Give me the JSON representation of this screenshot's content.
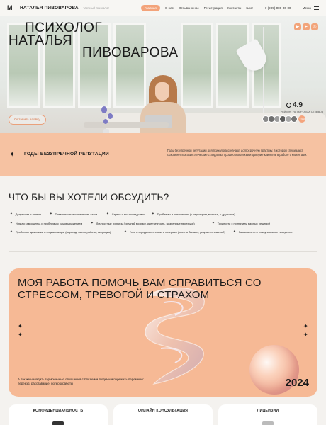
{
  "header": {
    "logo": "M",
    "brand": "НАТАЛЬЯ ПИВОВАРОВА",
    "brand_sub": "частный психолог",
    "nav": [
      "Главная",
      "О нас",
      "Отзывы о нас",
      "Регистрация",
      "Контакты",
      "Блог"
    ],
    "active_nav": "Главная",
    "phone": "+7 (999) 000-00-00",
    "menu_label": "Меню"
  },
  "hero": {
    "title_line1": "ПСИХОЛОГ",
    "title_line2": "НАТАЛЬЯ",
    "title_line3": "ПИВОВАРОВА",
    "cta_label": "Оставить заявку",
    "rating": "4.9",
    "rating_sub": "РЕЙТИНГ НА ПОРТАЛАХ ОТЗЫВОВ",
    "avatars_plus": "+4м",
    "social_icons": [
      "youtube-icon",
      "telegram-icon",
      "instagram-icon"
    ]
  },
  "reputation": {
    "title": "ГОДЫ БЕЗУПРЕЧНОЙ РЕПУТАЦИИ",
    "text": "Годы безупречной репутации для психолога означают долгосрочную практику, в которой специалист сохраняет высокие этические стандарты, профессионализм и доверие клиентов в работе с клиентами."
  },
  "topics": {
    "title": "ЧТО БЫ ВЫ ХОТЕЛИ ОБСУДИТЬ?",
    "items": [
      "Депрессия и апатия",
      "Тревожность и панические атаки",
      "Стресс и его последствия",
      "Проблемы в отношениях (с партнером, в семье, с друзьями)",
      "Низкая самооценка и проблемы с самовыражением",
      "Личностные кризисы (средний возраст, идентичность, жизненные переходы)",
      "Трудности с принятием важных решений",
      "Проблемы адаптации и социализации (переезд, смена работы, миграция)",
      "Горе и страдание в связи с потерями (смерть близких, разрыв отношений)",
      "Зависимости и компульсивное поведение"
    ]
  },
  "stress_card": {
    "title": "МОЯ РАБОТА ПОМОЧЬ ВАМ СПРАВИТЬСЯ СО СТРЕССОМ, ТРЕВОГОЙ И СТРАХОМ",
    "text": "А так же наладить гармоничные отношения с близкими людьми и пережить перемены: переезд, расставание, потерю работы",
    "year": "2024"
  },
  "features": [
    {
      "title": "КОНФИДЕНЦИАЛЬНОСТЬ"
    },
    {
      "title": "ОНЛАЙН КОНСУЛЬТАЦИЯ"
    },
    {
      "title": "ЛИЦЕНЗИИ"
    }
  ],
  "colors": {
    "accent": "#f3a37a",
    "peach_band": "#f6c2a2",
    "card_bg": "#f6b995",
    "page_bg": "#f4f2ef"
  }
}
